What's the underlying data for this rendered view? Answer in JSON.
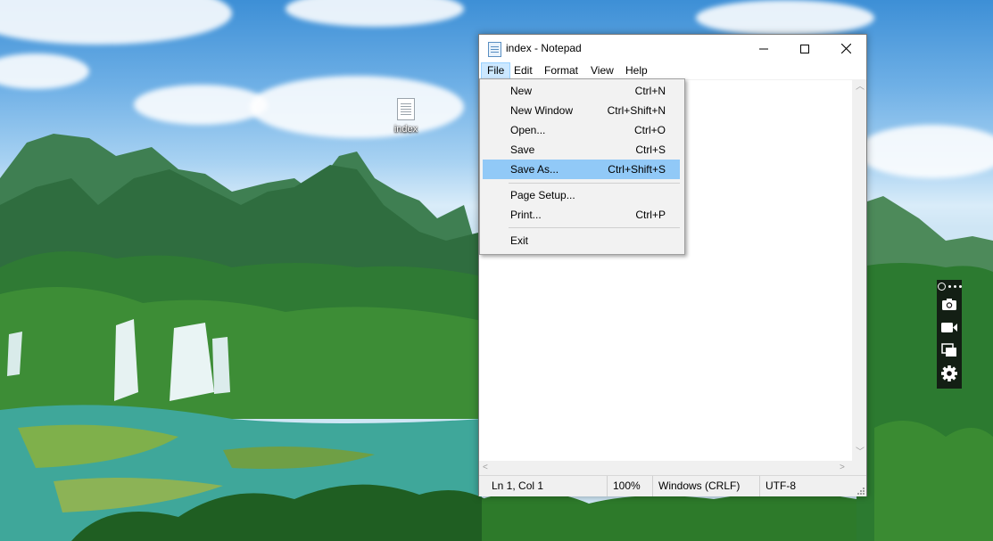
{
  "desktop": {
    "icons": [
      {
        "label": "index"
      }
    ]
  },
  "window": {
    "title": "index - Notepad",
    "caption": {
      "minimize": "—",
      "maximize": "☐",
      "close": "✕"
    }
  },
  "menubar": [
    {
      "label": "File"
    },
    {
      "label": "Edit"
    },
    {
      "label": "Format"
    },
    {
      "label": "View"
    },
    {
      "label": "Help"
    }
  ],
  "file_menu": {
    "items": [
      {
        "label": "New",
        "shortcut": "Ctrl+N"
      },
      {
        "label": "New Window",
        "shortcut": "Ctrl+Shift+N"
      },
      {
        "label": "Open...",
        "shortcut": "Ctrl+O"
      },
      {
        "label": "Save",
        "shortcut": "Ctrl+S"
      },
      {
        "label": "Save As...",
        "shortcut": "Ctrl+Shift+S",
        "highlighted": true
      },
      {
        "label": "Page Setup...",
        "shortcut": ""
      },
      {
        "label": "Print...",
        "shortcut": "Ctrl+P"
      },
      {
        "label": "Exit",
        "shortcut": ""
      }
    ]
  },
  "statusbar": {
    "position": "Ln 1, Col 1",
    "zoom": "100%",
    "line_endings": "Windows (CRLF)",
    "encoding": "UTF-8"
  },
  "capture_toolbar": {
    "buttons": [
      "camera-icon",
      "video-icon",
      "windows-icon",
      "gear-icon"
    ]
  },
  "colors": {
    "menu_highlight": "#91c9f7",
    "active_menu": "#cce8ff"
  }
}
